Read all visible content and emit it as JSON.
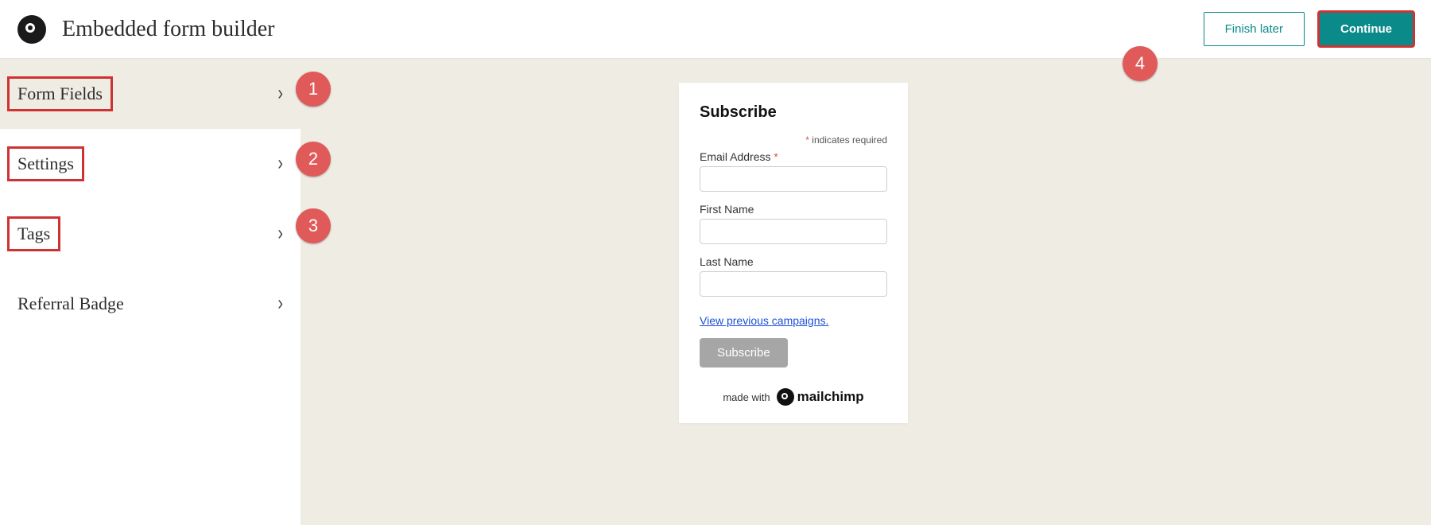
{
  "header": {
    "title": "Embedded form builder",
    "finish_later_label": "Finish later",
    "continue_label": "Continue"
  },
  "sidebar": {
    "items": [
      {
        "label": "Form Fields",
        "highlight": true,
        "active": true
      },
      {
        "label": "Settings",
        "highlight": true,
        "active": false
      },
      {
        "label": "Tags",
        "highlight": true,
        "active": false
      },
      {
        "label": "Referral Badge",
        "highlight": false,
        "active": false
      }
    ]
  },
  "preview": {
    "form_title": "Subscribe",
    "required_note_prefix": "*",
    "required_note_text": " indicates required",
    "fields": [
      {
        "label": "Email Address",
        "required": true,
        "value": ""
      },
      {
        "label": "First Name",
        "required": false,
        "value": ""
      },
      {
        "label": "Last Name",
        "required": false,
        "value": ""
      }
    ],
    "previous_campaigns_link": "View previous campaigns.",
    "subscribe_label": "Subscribe",
    "made_with_text": "made with",
    "brand_name": "mailchimp"
  },
  "callouts": {
    "1": "1",
    "2": "2",
    "3": "3",
    "4": "4"
  }
}
